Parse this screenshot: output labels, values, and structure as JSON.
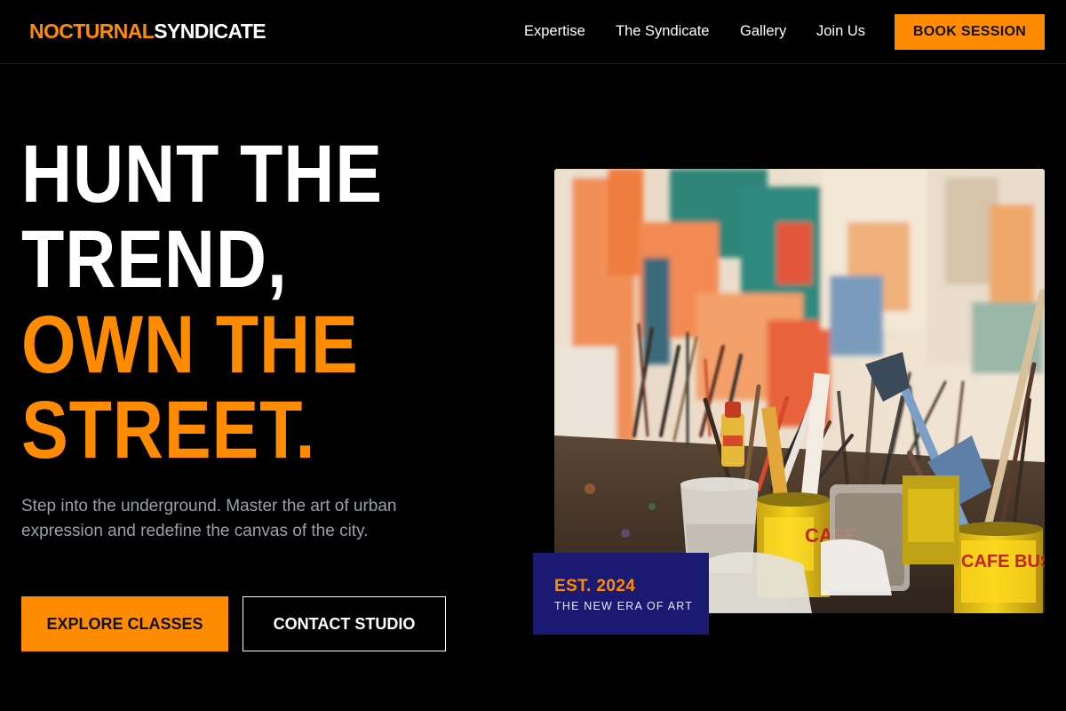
{
  "brand": {
    "part1": "NOCTURNAL",
    "part2": "SYNDICATE"
  },
  "nav": {
    "items": [
      {
        "label": "Expertise"
      },
      {
        "label": "The Syndicate"
      },
      {
        "label": "Gallery"
      },
      {
        "label": "Join Us"
      }
    ],
    "cta": "BOOK SESSION"
  },
  "hero": {
    "headline": {
      "line1": "HUNT THE",
      "line2": "TREND,",
      "line3": "OWN THE",
      "line4": "STREET."
    },
    "subtext": "Step into the underground. Master the art of urban expression and redefine the canvas of the city.",
    "primary_cta": "EXPLORE CLASSES",
    "secondary_cta": "CONTACT STUDIO"
  },
  "badge": {
    "year": "EST. 2024",
    "tagline": "THE NEW ERA OF ART"
  },
  "can_labels": {
    "left": "CAFE",
    "right": "CAFE BUSTELO"
  },
  "colors": {
    "accent": "#ff8c00",
    "background": "#000000",
    "badge_bg": "#1b1a73",
    "muted_text": "#9aa0aa"
  }
}
